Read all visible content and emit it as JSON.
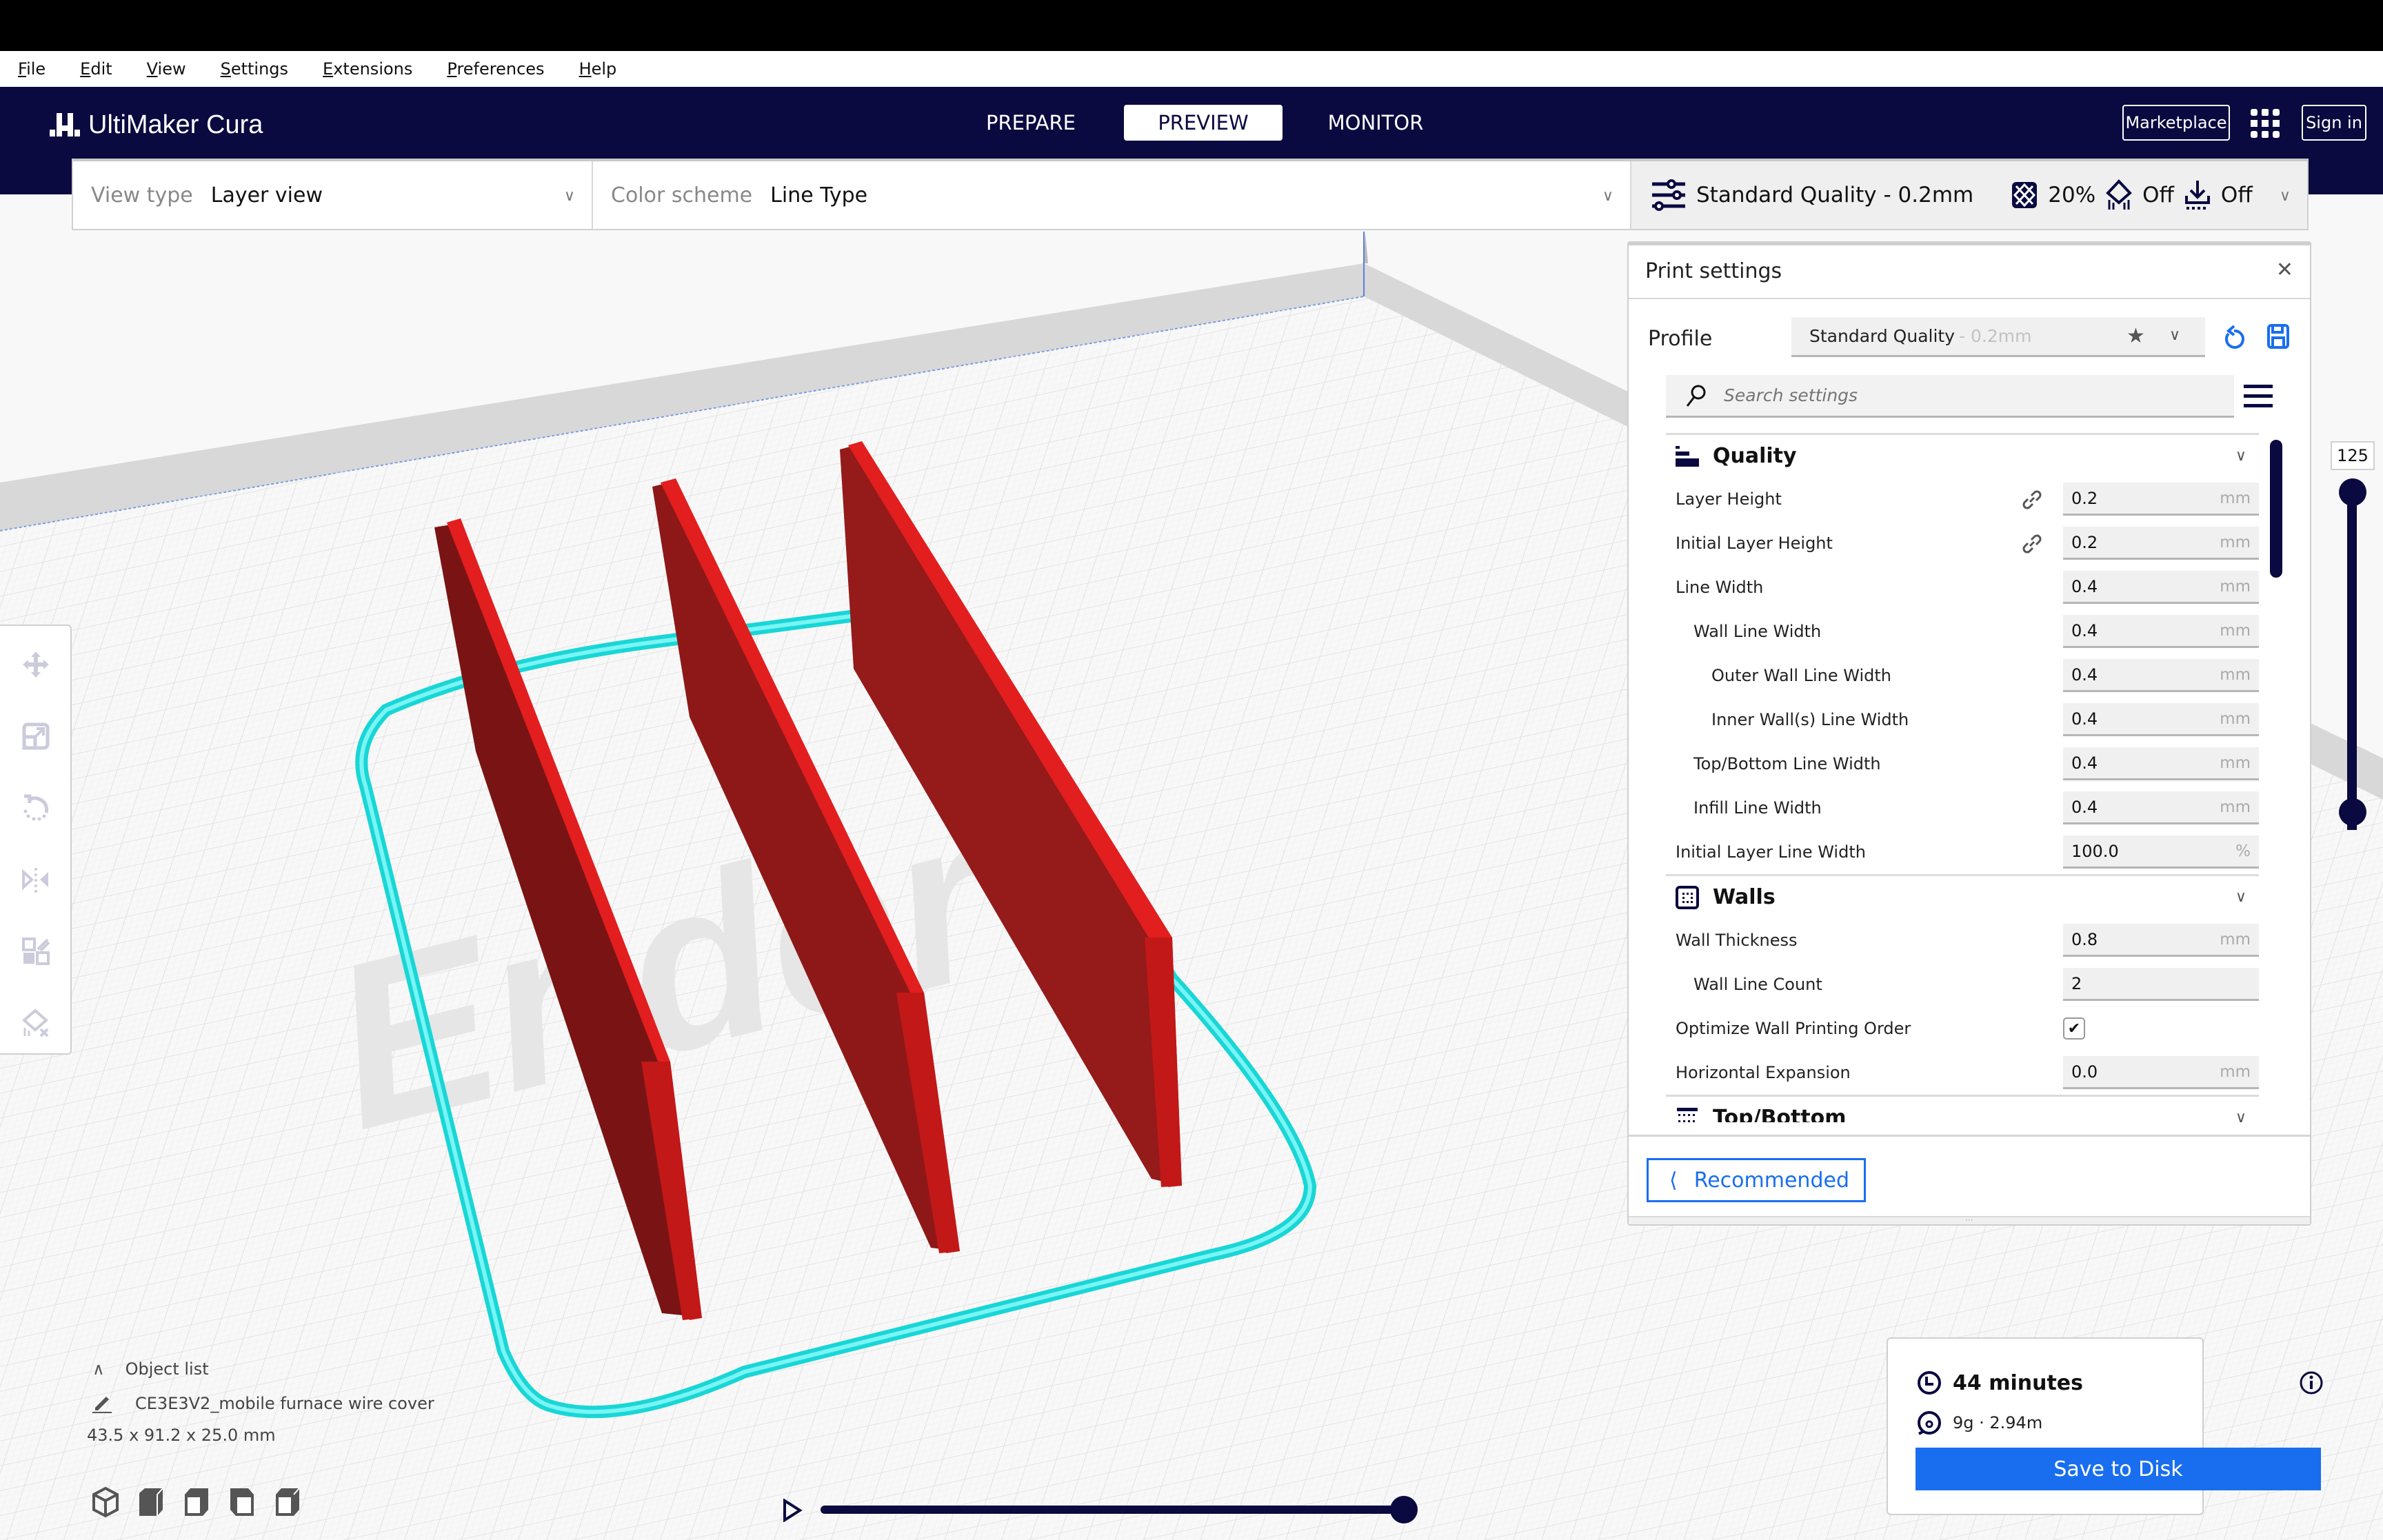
{
  "menu": [
    "File",
    "Edit",
    "View",
    "Settings",
    "Extensions",
    "Preferences",
    "Help"
  ],
  "header": {
    "app_name": "UltiMaker Cura",
    "tabs": [
      {
        "label": "PREPARE",
        "active": false
      },
      {
        "label": "PREVIEW",
        "active": true
      },
      {
        "label": "MONITOR",
        "active": false
      }
    ],
    "marketplace_label": "Marketplace",
    "signin_label": "Sign in"
  },
  "viewbar": {
    "view_type_label": "View type",
    "view_type_value": "Layer view",
    "color_scheme_label": "Color scheme",
    "color_scheme_value": "Line Type",
    "quality_summary": "Standard Quality - 0.2mm",
    "infill": "20%",
    "support": "Off",
    "adhesion": "Off"
  },
  "print_settings": {
    "title": "Print settings",
    "profile_label": "Profile",
    "profile_name": "Standard Quality",
    "profile_sub": "- 0.2mm",
    "search_placeholder": "Search settings",
    "categories": [
      {
        "name": "Quality",
        "icon": "quality-icon",
        "rows": [
          {
            "label": "Layer Height",
            "indent": 0,
            "value": "0.2",
            "unit": "mm",
            "linked": true
          },
          {
            "label": "Initial Layer Height",
            "indent": 0,
            "value": "0.2",
            "unit": "mm",
            "linked": true
          },
          {
            "label": "Line Width",
            "indent": 0,
            "value": "0.4",
            "unit": "mm"
          },
          {
            "label": "Wall Line Width",
            "indent": 1,
            "value": "0.4",
            "unit": "mm"
          },
          {
            "label": "Outer Wall Line Width",
            "indent": 2,
            "value": "0.4",
            "unit": "mm"
          },
          {
            "label": "Inner Wall(s) Line Width",
            "indent": 2,
            "value": "0.4",
            "unit": "mm"
          },
          {
            "label": "Top/Bottom Line Width",
            "indent": 1,
            "value": "0.4",
            "unit": "mm"
          },
          {
            "label": "Infill Line Width",
            "indent": 1,
            "value": "0.4",
            "unit": "mm"
          },
          {
            "label": "Initial Layer Line Width",
            "indent": 0,
            "value": "100.0",
            "unit": "%"
          }
        ]
      },
      {
        "name": "Walls",
        "icon": "walls-icon",
        "rows": [
          {
            "label": "Wall Thickness",
            "indent": 0,
            "value": "0.8",
            "unit": "mm"
          },
          {
            "label": "Wall Line Count",
            "indent": 1,
            "value": "2",
            "unit": ""
          },
          {
            "label": "Optimize Wall Printing Order",
            "indent": 0,
            "checkbox": true,
            "checked": true
          },
          {
            "label": "Horizontal Expansion",
            "indent": 0,
            "value": "0.0",
            "unit": "mm"
          }
        ]
      },
      {
        "name": "Top/Bottom",
        "icon": "top-bottom-icon",
        "rows": []
      }
    ],
    "recommended_label": "Recommended"
  },
  "layer_slider": {
    "value": "125"
  },
  "object_list": {
    "header": "Object list",
    "object_name": "CE3E3V2_mobile furnace wire cover",
    "dimensions": "43.5 x 91.2 x 25.0 mm"
  },
  "simulation": {
    "progress_percent": 100
  },
  "summary": {
    "time": "44 minutes",
    "material": "9g · 2.94m",
    "save_label": "Save to Disk"
  },
  "colors": {
    "header_bg": "#0a0940",
    "accent_blue": "#196ef0",
    "wall_red": "#e01b1b",
    "skirt_cyan": "#1de9e9"
  }
}
